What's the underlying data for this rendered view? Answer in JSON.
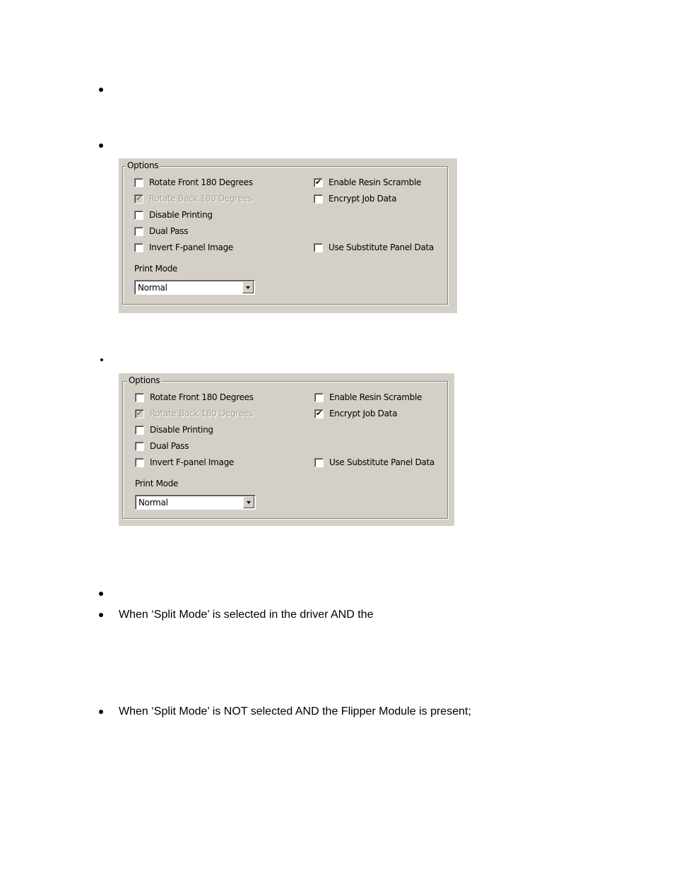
{
  "document": {
    "bullets": [
      {
        "text": ""
      },
      {
        "text": ""
      },
      {
        "text": ""
      },
      {
        "text": ""
      },
      {
        "text": "When ‘Split Mode’ is selected in the driver AND the"
      },
      {
        "text": "When ‘Split Mode’ is NOT selected AND the Flipper Module is present;"
      }
    ]
  },
  "dialogs": [
    {
      "group_label": "Options",
      "left_options": [
        {
          "label": "Rotate Front 180 Degrees",
          "checked": false,
          "disabled": false
        },
        {
          "label": "Rotate Back 180 Degrees",
          "checked": true,
          "disabled": true
        },
        {
          "label": "Disable Printing",
          "checked": false,
          "disabled": false
        },
        {
          "label": "Dual Pass",
          "checked": false,
          "disabled": false
        },
        {
          "label": "Invert F-panel Image",
          "checked": false,
          "disabled": false
        }
      ],
      "right_options": [
        {
          "label": "Enable Resin Scramble",
          "checked": true,
          "disabled": false
        },
        {
          "label": "Encrypt Job Data",
          "checked": false,
          "disabled": false
        },
        {
          "label": "Use Substitute Panel Data",
          "checked": false,
          "disabled": false
        }
      ],
      "print_mode_label": "Print Mode",
      "print_mode_value": "Normal"
    },
    {
      "group_label": "Options",
      "left_options": [
        {
          "label": "Rotate Front 180 Degrees",
          "checked": false,
          "disabled": false
        },
        {
          "label": "Rotate Back 180 Degrees",
          "checked": true,
          "disabled": true
        },
        {
          "label": "Disable Printing",
          "checked": false,
          "disabled": false
        },
        {
          "label": "Dual Pass",
          "checked": false,
          "disabled": false
        },
        {
          "label": "Invert F-panel Image",
          "checked": false,
          "disabled": false
        }
      ],
      "right_options": [
        {
          "label": "Enable Resin Scramble",
          "checked": false,
          "disabled": false
        },
        {
          "label": "Encrypt Job Data",
          "checked": true,
          "disabled": false
        },
        {
          "label": "Use Substitute Panel Data",
          "checked": false,
          "disabled": false
        }
      ],
      "print_mode_label": "Print Mode",
      "print_mode_value": "Normal"
    }
  ],
  "icons": {
    "checkmark": "✔",
    "dropdown_arrow": "chevron-down-icon"
  }
}
